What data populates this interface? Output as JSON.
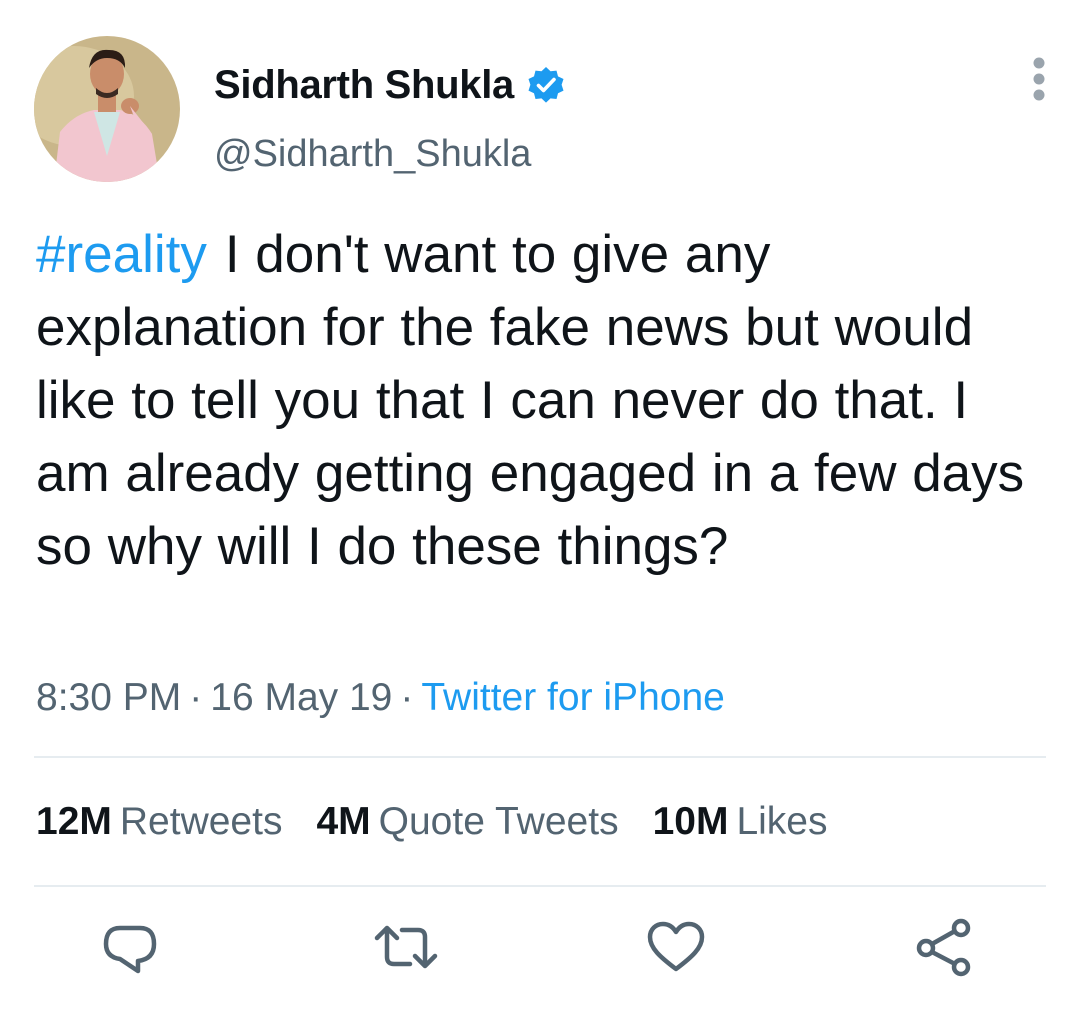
{
  "user": {
    "display_name": "Sidharth Shukla",
    "handle": "@Sidharth_Shukla",
    "verified": true
  },
  "tweet": {
    "hashtag": "#reality",
    "body": "I don't want to give any explanation for the fake news but would like to tell you that I can never do that. I am already getting engaged in a few days so why will I do these things?",
    "time": "8:30 PM",
    "date": "16 May 19",
    "source": "Twitter for iPhone",
    "separator": "·"
  },
  "stats": [
    {
      "count": "12M",
      "label": "Retweets"
    },
    {
      "count": "4M",
      "label": "Quote Tweets"
    },
    {
      "count": "10M",
      "label": "Likes"
    }
  ],
  "icons": {
    "verified": "verified-badge-icon",
    "more": "more-vertical-icon",
    "reply": "reply-icon",
    "retweet": "retweet-icon",
    "like": "heart-icon",
    "share": "share-icon"
  },
  "colors": {
    "accent": "#1d9bf0",
    "secondary_text": "#536471",
    "primary_text": "#0f1419",
    "divider": "#e6ecf0"
  }
}
